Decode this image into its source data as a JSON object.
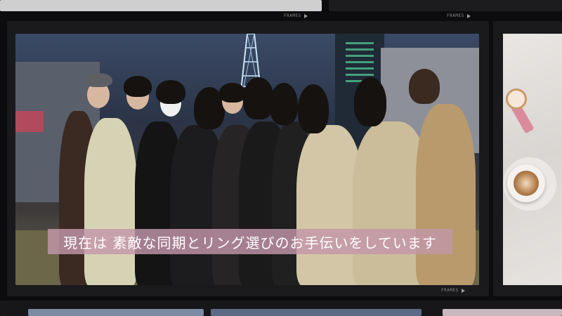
{
  "caption": {
    "text": "現在は 素敵な同期とリング選びのお手伝いをしています"
  },
  "film": {
    "frames_label": "FRAMES",
    "top_frames_label": "FRAMES",
    "bottom_frames_label": "FRAMES"
  },
  "colors": {
    "background": "#0c0c0e",
    "caption_bg": "#c396aa",
    "caption_text": "#ffffff"
  },
  "icons": [
    "play-triangle-icon"
  ]
}
